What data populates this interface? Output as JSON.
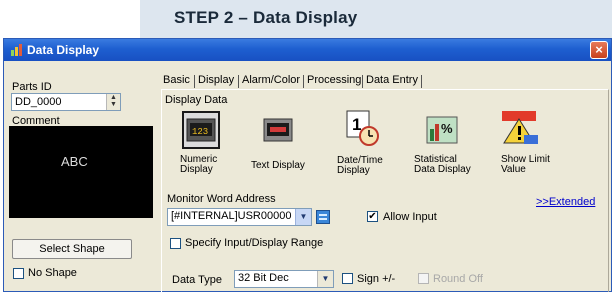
{
  "banner": {
    "text": "STEP 2 – Data Display"
  },
  "window": {
    "title": "Data Display",
    "close_glyph": "×",
    "icon": "data-display-icon"
  },
  "left": {
    "parts_id_label": "Parts ID",
    "parts_id_value": "DD_0000",
    "comment_label": "Comment",
    "comment_value": "",
    "preview_text": "ABC",
    "select_shape_label": "Select Shape",
    "no_shape_label": "No Shape",
    "no_shape_checked": false
  },
  "tabs": [
    "Basic",
    "Display",
    "Alarm/Color",
    "Processing",
    "Data Entry"
  ],
  "active_tab": "Basic",
  "display_data": {
    "label": "Display Data",
    "options": [
      {
        "label": "Numeric\nDisplay",
        "icon": "numeric-display-icon",
        "selected": true
      },
      {
        "label": "Text Display",
        "icon": "text-display-icon",
        "selected": false
      },
      {
        "label": "Date/Time\nDisplay",
        "icon": "date-time-icon",
        "selected": false
      },
      {
        "label": "Statistical\nData Display",
        "icon": "statistical-icon",
        "selected": false
      },
      {
        "label": "Show Limit\nValue",
        "icon": "show-limit-icon",
        "selected": false
      }
    ]
  },
  "monitor": {
    "label": "Monitor Word Address",
    "value": "[#INTERNAL]USR00000",
    "extended_link": ">>Extended",
    "allow_input_label": "Allow Input",
    "allow_input_checked": true,
    "specify_range_label": "Specify Input/Display Range",
    "specify_range_checked": false
  },
  "data_type": {
    "label": "Data Type",
    "value": "32 Bit Dec",
    "sign_label": "Sign +/-",
    "sign_checked": false,
    "round_off_label": "Round Off",
    "round_off_checked": false
  },
  "colors": {
    "title_bar": "#1e5fd0",
    "banner_bg": "#dde6ef",
    "dialog_bg": "#ece9d8"
  }
}
